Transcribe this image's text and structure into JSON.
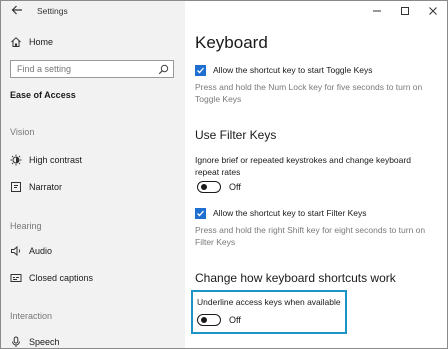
{
  "window": {
    "title": "Settings",
    "controls": [
      "minimize",
      "maximize",
      "close"
    ]
  },
  "sidebar": {
    "home_label": "Home",
    "search_placeholder": "Find a setting",
    "current_section": "Ease of Access",
    "groups": [
      {
        "header": "Vision",
        "items": [
          {
            "label": "High contrast",
            "icon": "sun-icon"
          },
          {
            "label": "Narrator",
            "icon": "narrator-icon"
          }
        ]
      },
      {
        "header": "Hearing",
        "items": [
          {
            "label": "Audio",
            "icon": "speaker-icon"
          },
          {
            "label": "Closed captions",
            "icon": "captions-icon"
          }
        ]
      },
      {
        "header": "Interaction",
        "items": [
          {
            "label": "Speech",
            "icon": "microphone-icon"
          }
        ]
      }
    ]
  },
  "main": {
    "page_title": "Keyboard",
    "toggle_keys_checkbox": {
      "label": "Allow the shortcut key to start Toggle Keys",
      "checked": true
    },
    "toggle_keys_desc_line1": "Press and hold the Num Lock key for five seconds to turn on",
    "toggle_keys_desc_line2": "Toggle Keys",
    "filter_keys": {
      "title": "Use Filter Keys",
      "desc_line1": "Ignore brief or repeated keystrokes and change keyboard",
      "desc_line2": "repeat rates",
      "toggle_state": "Off",
      "checkbox": {
        "label": "Allow the shortcut key to start Filter Keys",
        "checked": true
      },
      "help_line1": "Press and hold the right Shift key for eight seconds to turn on",
      "help_line2": "Filter Keys"
    },
    "shortcuts": {
      "title": "Change how keyboard shortcuts work",
      "underline_label": "Underline access keys when available",
      "toggle_state": "Off"
    }
  },
  "colors": {
    "accent": "#1f6fd0",
    "highlight_border": "#1b93c7",
    "sidebar_bg": "#f2f2f2"
  }
}
